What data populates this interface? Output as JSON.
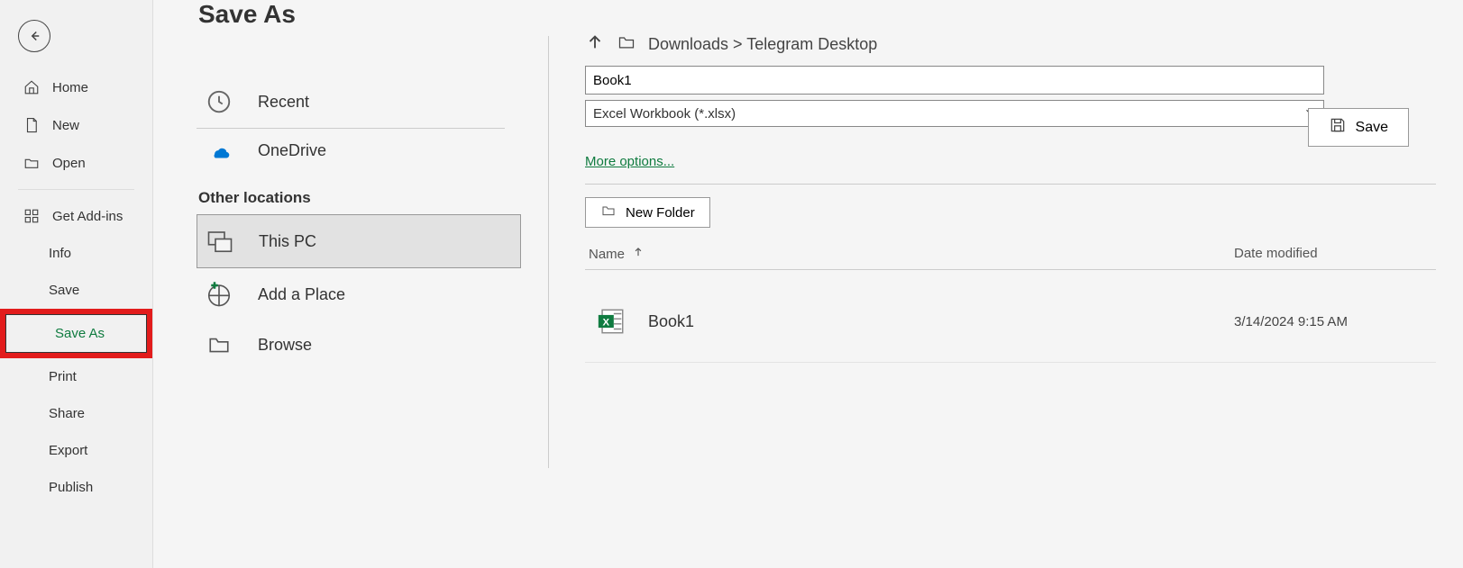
{
  "sidebar": {
    "home": "Home",
    "new": "New",
    "open": "Open",
    "addins": "Get Add-ins",
    "info": "Info",
    "save": "Save",
    "saveas": "Save As",
    "print": "Print",
    "share": "Share",
    "export": "Export",
    "publish": "Publish"
  },
  "page": {
    "title": "Save As"
  },
  "locations": {
    "recent": "Recent",
    "onedrive": "OneDrive",
    "other_header": "Other locations",
    "thispc": "This PC",
    "addplace": "Add a Place",
    "browse": "Browse"
  },
  "breadcrumb": {
    "path": "Downloads > Telegram Desktop"
  },
  "filename": {
    "value": "Book1"
  },
  "filetype": {
    "selected": "Excel Workbook (*.xlsx)"
  },
  "buttons": {
    "save": "Save",
    "more": "More options...",
    "newfolder": "New Folder"
  },
  "columns": {
    "name": "Name",
    "date": "Date modified"
  },
  "files": [
    {
      "name": "Book1",
      "date": "3/14/2024 9:15 AM"
    }
  ]
}
